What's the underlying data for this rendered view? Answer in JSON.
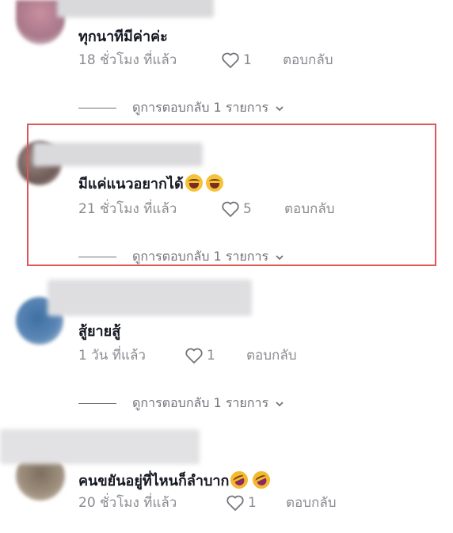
{
  "comments": [
    {
      "text": "ทุกนาทีมีค่าค่ะ",
      "time": "18 ชั่วโมง ที่แล้ว",
      "likes": "1",
      "reply": "ตอบกลับ",
      "view_replies": "ดูการตอบกลับ 1 รายการ",
      "emojis": []
    },
    {
      "text": "มีแค่แนวอยากได้",
      "time": "21 ชั่วโมง ที่แล้ว",
      "likes": "5",
      "reply": "ตอบกลับ",
      "view_replies": "ดูการตอบกลับ 1 รายการ",
      "emojis": [
        "face-with-tears-of-joy-icon",
        "face-with-tears-of-joy-icon"
      ]
    },
    {
      "text": "สู้ยายสู้",
      "time": "1 วัน ที่แล้ว",
      "likes": "1",
      "reply": "ตอบกลับ",
      "view_replies": "ดูการตอบกลับ 1 รายการ",
      "emojis": []
    },
    {
      "text": "คนขยันอยู่ที่ไหนก็ลำบาก",
      "time": "20 ชั่วโมง ที่แล้ว",
      "likes": "1",
      "reply": "ตอบกลับ",
      "emojis": [
        "rolling-on-floor-laughing-icon",
        "rolling-on-floor-laughing-icon"
      ]
    }
  ],
  "colors": {
    "highlight_border": "#e05557",
    "meta_text": "#8a8b91",
    "comment_text": "#161823"
  }
}
